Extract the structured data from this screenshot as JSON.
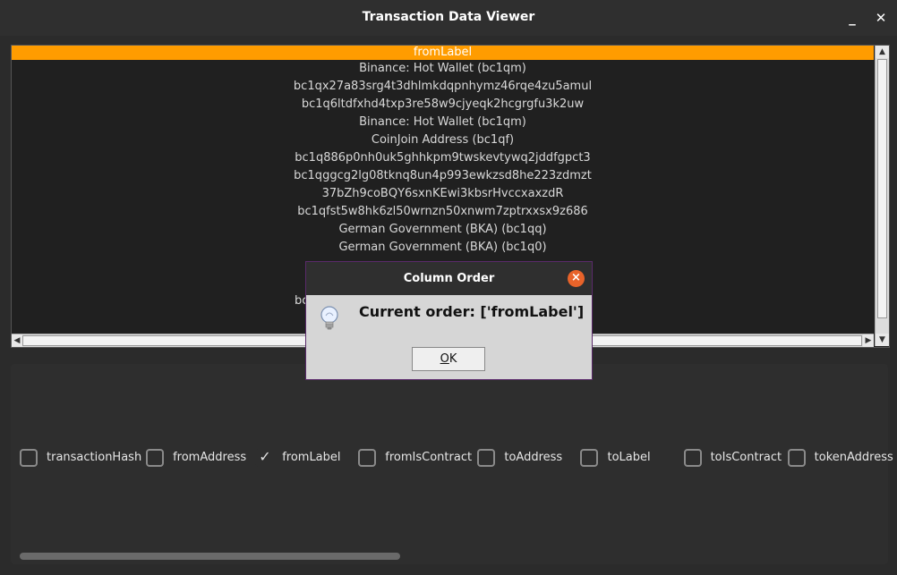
{
  "window": {
    "title": "Transaction Data Viewer",
    "minimize_glyph": "_",
    "close_glyph": "✕"
  },
  "table": {
    "header": "fromLabel",
    "rows": [
      "Binance: Hot Wallet (bc1qm)",
      "bc1qx27a83srg4t3dhlmkdqpnhymz46rqe4zu5amul",
      "bc1q6ltdfxhd4txp3re58w9cjyeqk2hcgrgfu3k2uw",
      "Binance: Hot Wallet (bc1qm)",
      "CoinJoin Address (bc1qf)",
      "bc1q886p0nh0uk5ghhkpm9twskevtywq2jddfgpct3",
      "bc1qggcg2lg08tknq8un4p993ewkzsd8he223zdmzt",
      "37bZh9coBQY6sxnKEwi3kbsrHvccxaxzdR",
      "bc1qfst5w8hk6zl50wrnzn50xnwm7zptrxxsx9z686",
      "German Government (BKA) (bc1qq)",
      "German Government (BKA) (bc1q0)",
      "",
      "",
      "bc"
    ]
  },
  "columns": [
    {
      "label": "transactionHash",
      "checked": false
    },
    {
      "label": "fromAddress",
      "checked": false
    },
    {
      "label": "fromLabel",
      "checked": true
    },
    {
      "label": "fromIsContract",
      "checked": false
    },
    {
      "label": "toAddress",
      "checked": false
    },
    {
      "label": "toLabel",
      "checked": false
    },
    {
      "label": "toIsContract",
      "checked": false
    },
    {
      "label": "tokenAddress",
      "checked": false
    },
    {
      "label": "",
      "checked": false
    }
  ],
  "dialog": {
    "title": "Column Order",
    "message": "Current order: ['fromLabel']",
    "ok_label_underlined": "O",
    "ok_label_rest": "K",
    "icon": "lightbulb-icon"
  },
  "colors": {
    "accent": "#ff9c00",
    "dialog_close": "#e8632a"
  }
}
